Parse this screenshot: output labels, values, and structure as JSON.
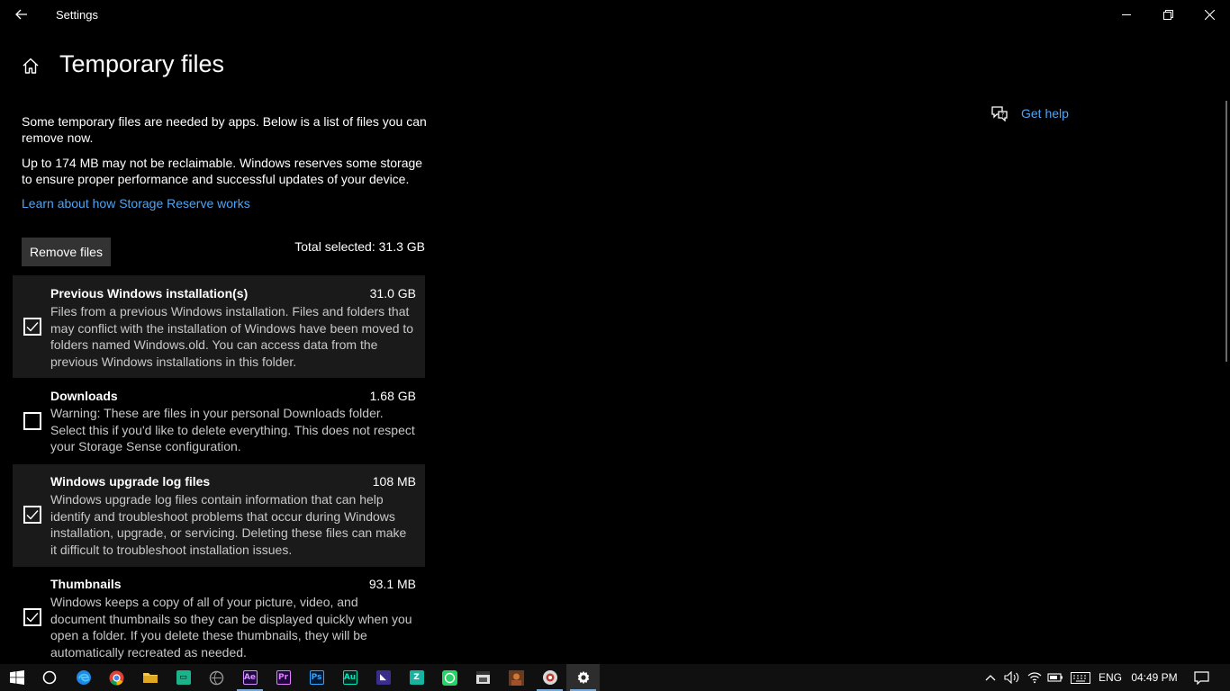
{
  "window": {
    "title": "Settings"
  },
  "page": {
    "title": "Temporary files",
    "description1": "Some temporary files are needed by apps. Below is a list of files you can remove now.",
    "description2": "Up to 174 MB may not be reclaimable. Windows reserves some storage to ensure proper performance and successful updates of your device.",
    "learn_link": "Learn about how Storage Reserve works",
    "remove_button": "Remove files",
    "total_selected": "Total selected: 31.3 GB"
  },
  "items": [
    {
      "name": "Previous Windows installation(s)",
      "size": "31.0 GB",
      "checked": true,
      "description": "Files from a previous Windows installation.  Files and folders that may conflict with the installation of Windows have been moved to folders named Windows.old.  You can access data from the previous Windows installations in this folder."
    },
    {
      "name": "Downloads",
      "size": "1.68 GB",
      "checked": false,
      "description": "Warning: These are files in your personal Downloads folder. Select this if you'd like to delete everything. This does not respect your Storage Sense configuration."
    },
    {
      "name": "Windows upgrade log files",
      "size": "108 MB",
      "checked": true,
      "description": "Windows upgrade log files contain information that can help identify and troubleshoot problems that occur during Windows installation, upgrade, or servicing.  Deleting these files can make it difficult to troubleshoot installation issues."
    },
    {
      "name": "Thumbnails",
      "size": "93.1 MB",
      "checked": true,
      "description": "Windows keeps a copy of all of your picture, video, and document thumbnails so they can be displayed quickly when you open a folder. If you delete these thumbnails, they will be automatically recreated as needed."
    }
  ],
  "help": {
    "label": "Get help",
    "icon": "help-chat-icon"
  },
  "taskbar": {
    "apps": [
      {
        "name": "start",
        "icon": "windows-logo-icon"
      },
      {
        "name": "search",
        "icon": "cortana-circle-icon"
      },
      {
        "name": "edge",
        "icon": "edge-icon"
      },
      {
        "name": "chrome",
        "icon": "chrome-icon"
      },
      {
        "name": "file-explorer",
        "icon": "folder-icon"
      },
      {
        "name": "app-green",
        "icon": "app-green-icon"
      },
      {
        "name": "app-gray",
        "icon": "app-gray-icon"
      },
      {
        "name": "after-effects",
        "icon": "after-effects-icon",
        "label": "Ae"
      },
      {
        "name": "premiere",
        "icon": "premiere-icon",
        "label": "Pr"
      },
      {
        "name": "photoshop",
        "icon": "photoshop-icon",
        "label": "Ps"
      },
      {
        "name": "audition",
        "icon": "audition-icon",
        "label": "Au"
      },
      {
        "name": "app-purple",
        "icon": "app-purple-icon"
      },
      {
        "name": "app-teal",
        "icon": "app-teal-icon"
      },
      {
        "name": "whatsapp",
        "icon": "whatsapp-icon"
      },
      {
        "name": "app-dark",
        "icon": "app-dark-icon"
      },
      {
        "name": "app-image",
        "icon": "app-image-icon"
      },
      {
        "name": "app-circle",
        "icon": "app-circle-icon"
      },
      {
        "name": "settings",
        "icon": "gear-icon"
      }
    ],
    "tray": {
      "language": "ENG",
      "time": "04:49 PM"
    }
  },
  "colors": {
    "accent_link": "#4ea4f2",
    "background": "#000000",
    "item_shade": "#1a1a1a",
    "button_bg": "#333333"
  }
}
